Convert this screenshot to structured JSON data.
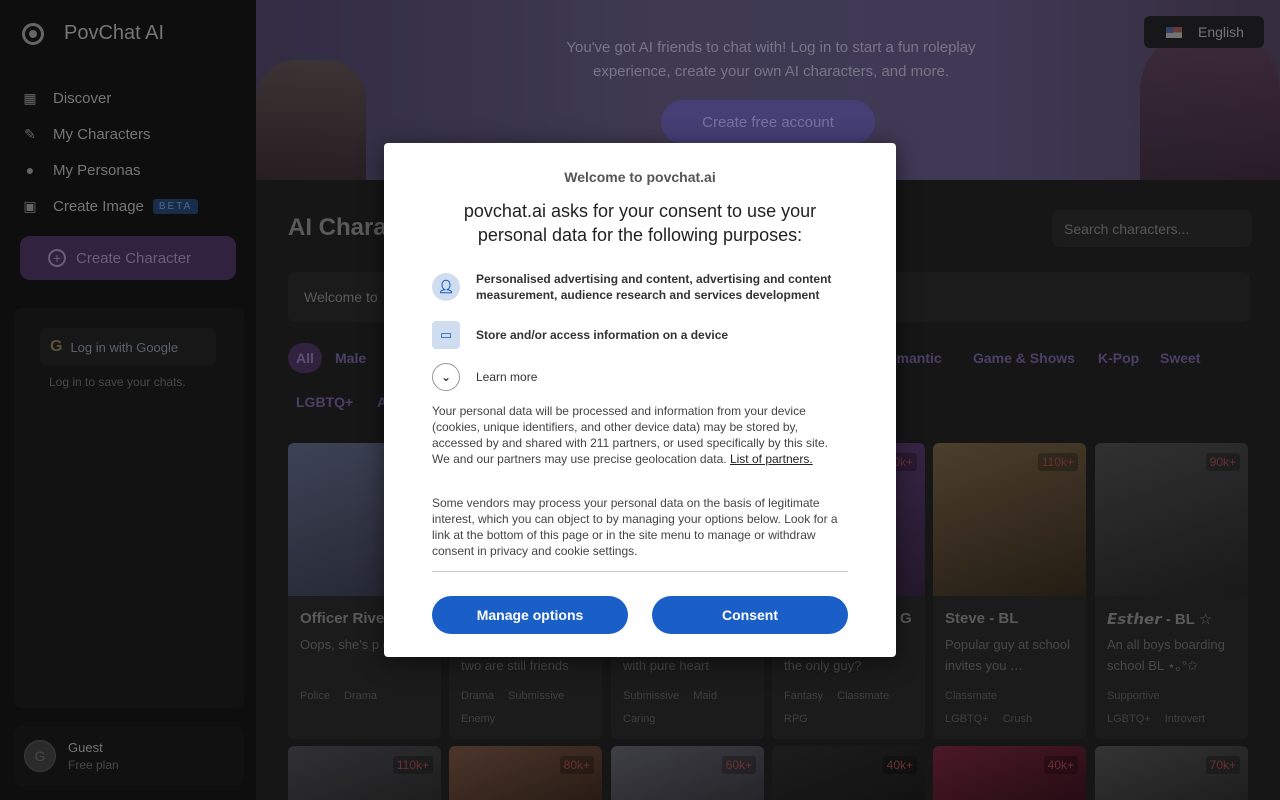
{
  "app": {
    "name": "PovChat AI"
  },
  "sidebar": {
    "nav": [
      {
        "label": "Discover",
        "icon": "grid-icon"
      },
      {
        "label": "My Characters",
        "icon": "pencil-icon"
      },
      {
        "label": "My Personas",
        "icon": "person-icon"
      },
      {
        "label": "Create Image",
        "icon": "image-icon"
      }
    ],
    "beta_badge": "BETA",
    "create_character": "Create Character",
    "login_google": "Log in with Google",
    "login_note": "Log in to save your chats.",
    "guest": {
      "initial": "G",
      "name": "Guest",
      "plan": "Free plan"
    }
  },
  "banner": {
    "text": "You've got AI friends to chat with! Log in to start a fun roleplay experience, create your own AI characters, and more.",
    "cta": "Create free account",
    "language": "English"
  },
  "main": {
    "title": "AI Charac",
    "search_placeholder": "Search characters...",
    "welcome": "Welcome to",
    "chips": [
      "All",
      "Male",
      "omantic",
      "Game & Shows",
      "K-Pop",
      "Sweet",
      "LGBTQ+",
      "A"
    ],
    "cards": [
      {
        "name": "Officer Rive",
        "desc": "Oops, she's p over you",
        "tags": [
          "Police",
          "Drama"
        ],
        "count": "",
        "color": "#3a3f52"
      },
      {
        "name": "",
        "desc": "two are still friends",
        "tags": [
          "Drama",
          "Submissive",
          "Enemy"
        ],
        "count": "",
        "color": "#3a2a2a"
      },
      {
        "name": "",
        "desc": "with pure heart",
        "tags": [
          "Submissive",
          "Maid",
          "Caring"
        ],
        "count": "",
        "color": "#2a2a35"
      },
      {
        "name": "G",
        "desc": "the only guy?",
        "tags": [
          "Fantasy",
          "Classmate",
          "RPG"
        ],
        "count": "0k+",
        "color": "#3a2a44"
      },
      {
        "name": "Steve - BL",
        "desc": "Popular guy at school invites you …",
        "tags": [
          "Classmate",
          "LGBTQ+",
          "Crush"
        ],
        "count": "110k+",
        "color": "#4a3e2c"
      },
      {
        "name": "𝙀𝙨𝙩𝙝𝙚𝙧 - BL ☆",
        "desc": "An all boys boarding school BL ⋆｡°✩",
        "tags": [
          "Supportive",
          "LGBTQ+",
          "Introvert"
        ],
        "count": "90k+",
        "color": "#2e2e2e"
      }
    ],
    "row2_counts": [
      "110k+",
      "80k+",
      "60k+",
      "40k+",
      "40k+",
      "70k+"
    ]
  },
  "consent": {
    "welcome": "Welcome to povchat.ai",
    "title": "povchat.ai asks for your consent to use your personal data for the following purposes:",
    "purposes": [
      "Personalised advertising and content, advertising and content measurement, audience research and services development",
      "Store and/or access information on a device"
    ],
    "learn_more": "Learn more",
    "para1": "Your personal data will be processed and information from your device (cookies, unique identifiers, and other device data) may be stored by, accessed by and shared with 211 partners, or used specifically by this site. We and our partners may use precise geolocation data.",
    "partners_link": "List of partners.",
    "para2": "Some vendors may process your personal data on the basis of legitimate interest, which you can object to by managing your options below. Look for a link at the bottom of this page or in the site menu to manage or withdraw consent in privacy and cookie settings.",
    "manage_button": "Manage options",
    "consent_button": "Consent"
  }
}
